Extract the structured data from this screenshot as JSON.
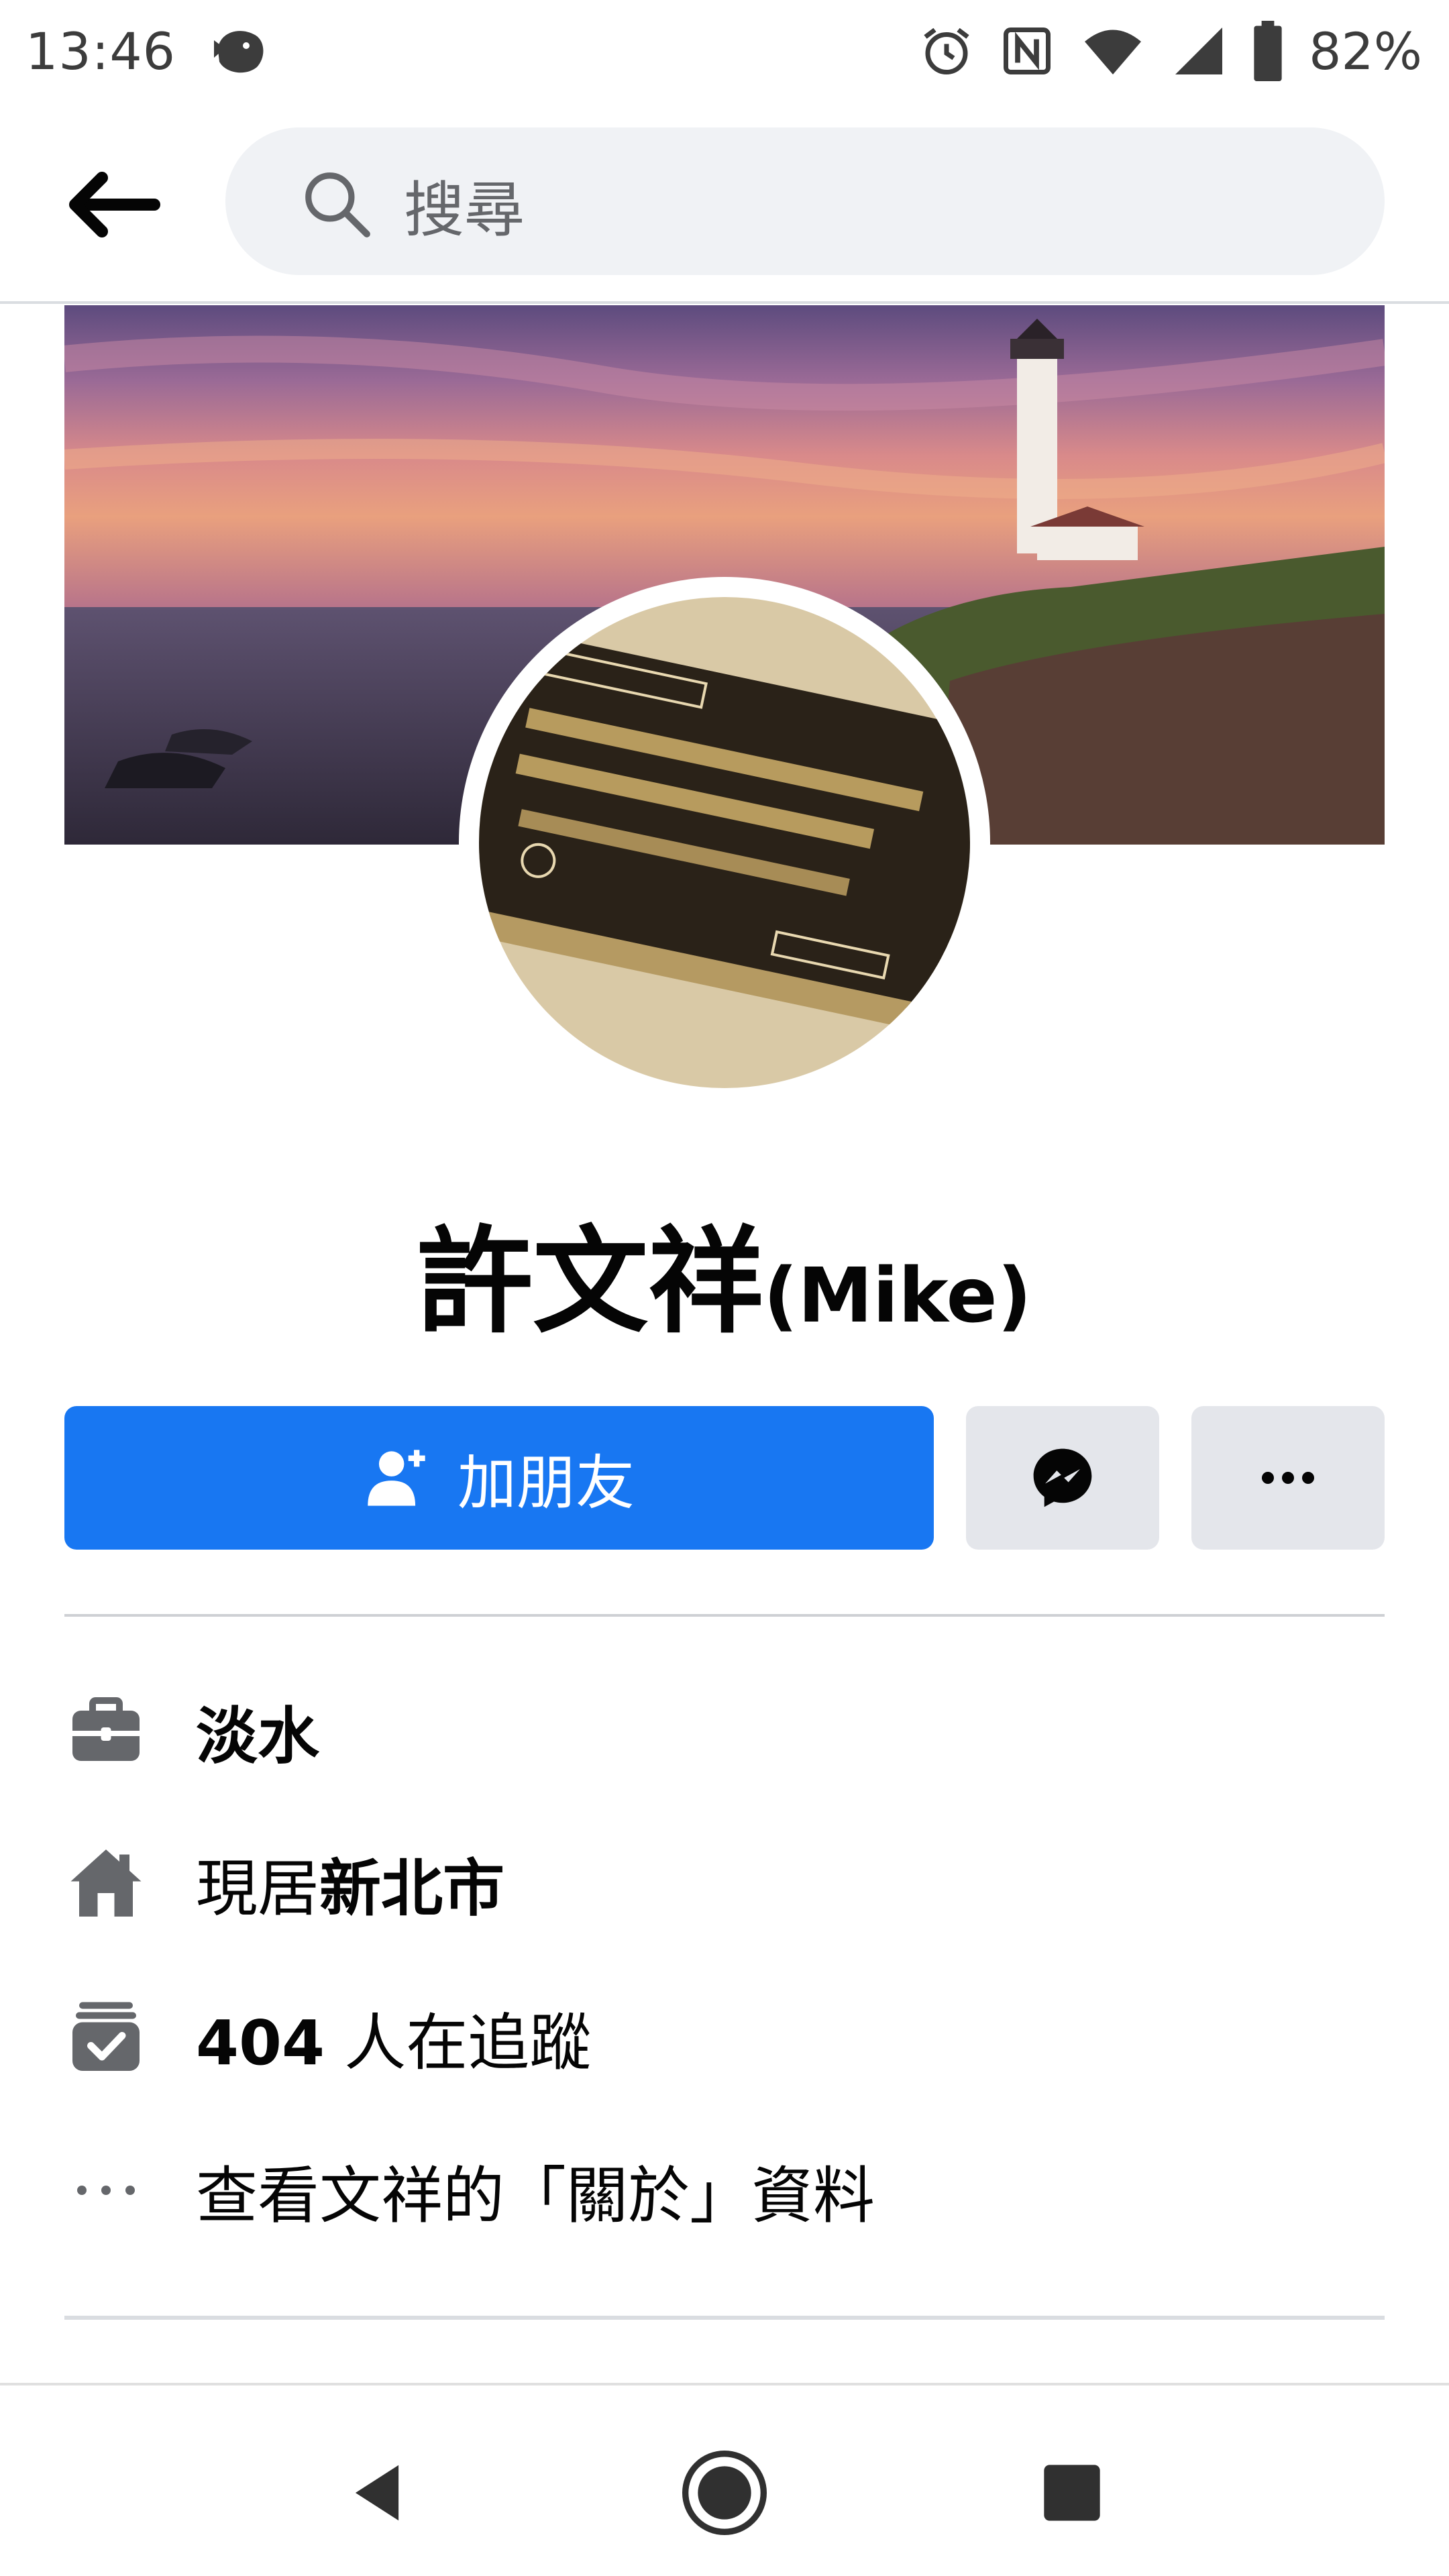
{
  "status_bar": {
    "time": "13:46",
    "battery": "82%",
    "icons": [
      "fish-notification-icon",
      "alarm-icon",
      "nfc-icon",
      "wifi-icon",
      "signal-icon",
      "battery-icon"
    ]
  },
  "top_nav": {
    "search_placeholder": "搜尋",
    "icons": [
      "back-arrow-icon",
      "search-icon"
    ]
  },
  "profile": {
    "name_cjk": "許文祥",
    "name_latin": "(Mike)",
    "cover_description_icon": "cover-photo",
    "avatar_icon": "avatar"
  },
  "actions": {
    "add_friend_label": "加朋友",
    "icons": [
      "add-person-icon",
      "messenger-icon",
      "more-dots-icon"
    ]
  },
  "details": {
    "work": "淡水",
    "lives_prefix": "現居",
    "lives_city": "新北市",
    "followers_count": "404",
    "followers_suffix": " 人在追蹤",
    "about_link": "查看文祥的「關於」資料"
  },
  "colors": {
    "primary": "#1877f2",
    "secondary_button": "#e4e6eb",
    "search_bg": "#f0f2f5",
    "icon_gray": "#65676b"
  }
}
